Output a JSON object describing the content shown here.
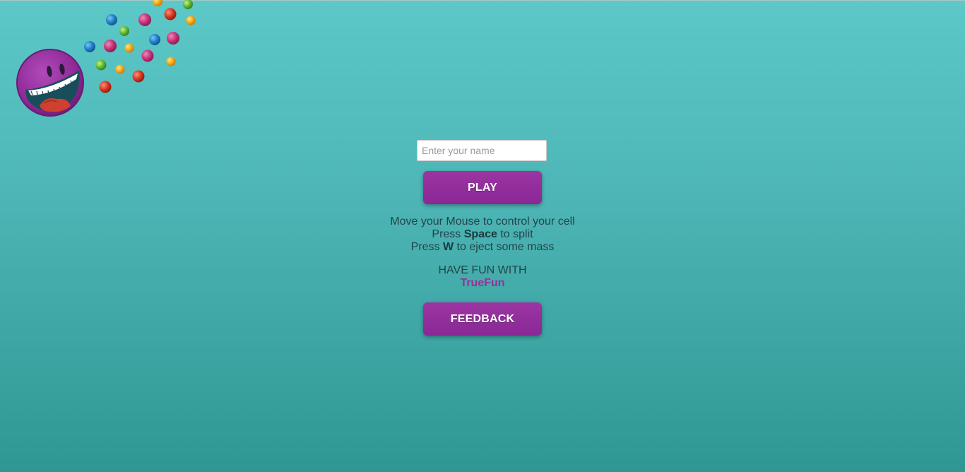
{
  "name_input": {
    "value": "",
    "placeholder": "Enter your name"
  },
  "play_button": {
    "label": "PLAY"
  },
  "instructions": {
    "line1": "Move your Mouse to control your cell",
    "line2_pre": "Press ",
    "line2_key": "Space",
    "line2_post": " to split",
    "line3_pre": "Press ",
    "line3_key": "W",
    "line3_post": " to eject some mass"
  },
  "fun": {
    "label": "HAVE FUN WITH",
    "brand": "TrueFun"
  },
  "feedback_button": {
    "label": "FEEDBACK"
  },
  "colors": {
    "background_top": "#5cc8c8",
    "background_bottom": "#2f9793",
    "button": "#8f2d99",
    "brand": "#9a2e9c",
    "text": "#22454a"
  },
  "icons": {
    "logo": "purple-cell-mascot-icon",
    "pellets": "candy-pellets-icon"
  }
}
